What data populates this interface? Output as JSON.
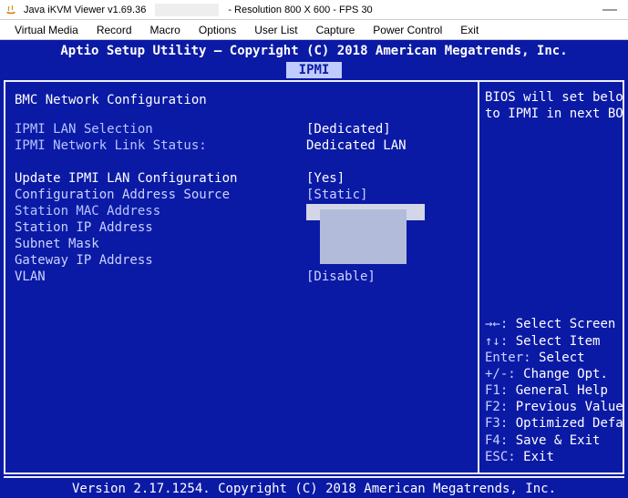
{
  "window": {
    "title_pre": "Java iKVM Viewer v1.69.36",
    "title_post": "- Resolution 800 X 600 - FPS 30"
  },
  "menu": {
    "virtual_media": "Virtual Media",
    "record": "Record",
    "macro": "Macro",
    "options": "Options",
    "user_list": "User List",
    "capture": "Capture",
    "power_control": "Power Control",
    "exit": "Exit"
  },
  "bios": {
    "header": "Aptio Setup Utility – Copyright (C) 2018 American Megatrends, Inc.",
    "tab": "IPMI",
    "title": "BMC Network Configuration",
    "lan_selection_label": "IPMI LAN Selection",
    "lan_selection_value": "[Dedicated]",
    "link_status_label": "IPMI Network Link Status:",
    "link_status_value": "Dedicated LAN",
    "update_label": "Update IPMI LAN Configuration",
    "update_value": "[Yes]",
    "config_source_label": "Configuration Address Source",
    "config_source_value": "[Static]",
    "mac_label": "Station MAC Address",
    "ip_label": "Station IP Address",
    "subnet_label": "Subnet Mask",
    "gateway_label": "Gateway IP Address",
    "vlan_label": "VLAN",
    "vlan_value": "[Disable]",
    "side_help_1": "BIOS will set below s",
    "side_help_2": "to IPMI in next BOOT",
    "keys": {
      "select_screen": "Select Screen",
      "select_item": "Select Item",
      "enter_label": "Enter:",
      "enter": "Select",
      "pm_label": "+/-:",
      "pm": "Change Opt.",
      "f1_label": "F1:",
      "f1": "General Help",
      "f2_label": "F2:",
      "f2": "Previous Values",
      "f3_label": "F3:",
      "f3": "Optimized Default",
      "f4_label": "F4:",
      "f4": "Save & Exit",
      "esc_label": "ESC:",
      "esc": "Exit"
    },
    "footer": "Version 2.17.1254. Copyright (C) 2018 American Megatrends, Inc."
  }
}
